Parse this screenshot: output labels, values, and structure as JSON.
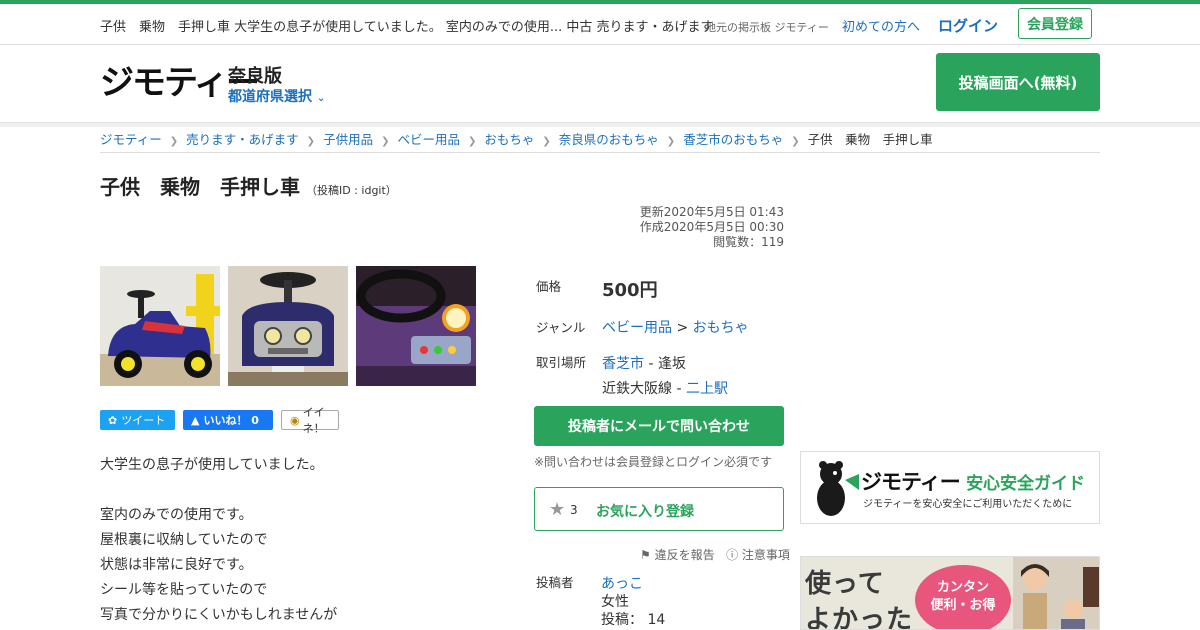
{
  "topbar": {
    "page_title": "子供　乗物　手押し車 大学生の息子が使用していました。 室内のみでの使用... 中古 売ります・あげます",
    "tagline": "地元の掲示板 ジモティー",
    "first_time": "初めての方へ",
    "login": "ログイン",
    "register": "会員登録"
  },
  "header": {
    "logo": "ジモティー",
    "edition": "奈良版",
    "pref_select": "都道府県選択",
    "post_button": "投稿画面へ(無料)"
  },
  "breadcrumb": [
    "ジモティー",
    "売ります・あげます",
    "子供用品",
    "ベビー用品",
    "おもちゃ",
    "奈良県のおもちゃ",
    "香芝市のおもちゃ",
    "子供　乗物　手押し車"
  ],
  "item": {
    "title": "子供　乗物　手押し車",
    "post_id": "（投稿ID : idgit）",
    "updated": "更新2020年5月5日 01:43",
    "created": "作成2020年5月5日 00:30",
    "views": "閲覧数：119"
  },
  "share": {
    "tweet": "ツイート",
    "like": "いいね！ 0",
    "iine": "イイネ！"
  },
  "description": [
    "大学生の息子が使用していました。",
    "",
    "室内のみでの使用です。",
    "屋根裏に収納していたので",
    "状態は非常に良好です。",
    "シール等を貼っていたので",
    "写真で分かりにくいかもしれませんが"
  ],
  "details": {
    "price_label": "価格",
    "price": "500円",
    "genre_label": "ジャンル",
    "genre_1": "ベビー用品",
    "genre_sep": " > ",
    "genre_2": "おもちゃ",
    "place_label": "取引場所",
    "place_city": "香芝市",
    "place_area": " - 逢坂",
    "place_line": "近鉄大阪線 - ",
    "place_station": "二上駅"
  },
  "actions": {
    "mail_button": "投稿者にメールで問い合わせ",
    "note": "※問い合わせは会員登録とログイン必須です",
    "fav_count": "3",
    "fav_label": "お気に入り登録",
    "report": "違反を報告",
    "caution": "注意事項"
  },
  "poster": {
    "label": "投稿者",
    "name": "あっこ",
    "gender": "女性",
    "posts": "投稿：  14"
  },
  "banners": {
    "guide_logo": "ジモティー",
    "guide_title": "安心安全ガイド",
    "guide_sub": "ジモティーを安心安全にご利用いただくために",
    "ad_line1": "使って",
    "ad_line2": "よかった",
    "ad_pink_1": "カンタン",
    "ad_pink_2": "便利・お得"
  }
}
